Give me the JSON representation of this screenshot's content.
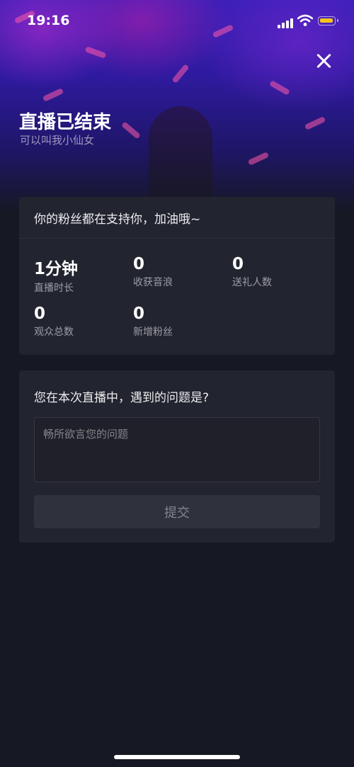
{
  "status_bar": {
    "time": "19:16"
  },
  "header": {
    "title": "直播已结束",
    "subtitle": "可以叫我小仙女"
  },
  "summary": {
    "message": "你的粉丝都在支持你，加油哦~",
    "stats": [
      {
        "value": "1分钟",
        "label": "直播时长"
      },
      {
        "value": "0",
        "label": "收获音浪"
      },
      {
        "value": "0",
        "label": "送礼人数"
      },
      {
        "value": "0",
        "label": "观众总数"
      },
      {
        "value": "0",
        "label": "新增粉丝"
      }
    ]
  },
  "feedback": {
    "question": "您在本次直播中，遇到的问题是?",
    "placeholder": "畅所欲言您的问题",
    "submit_label": "提交"
  }
}
